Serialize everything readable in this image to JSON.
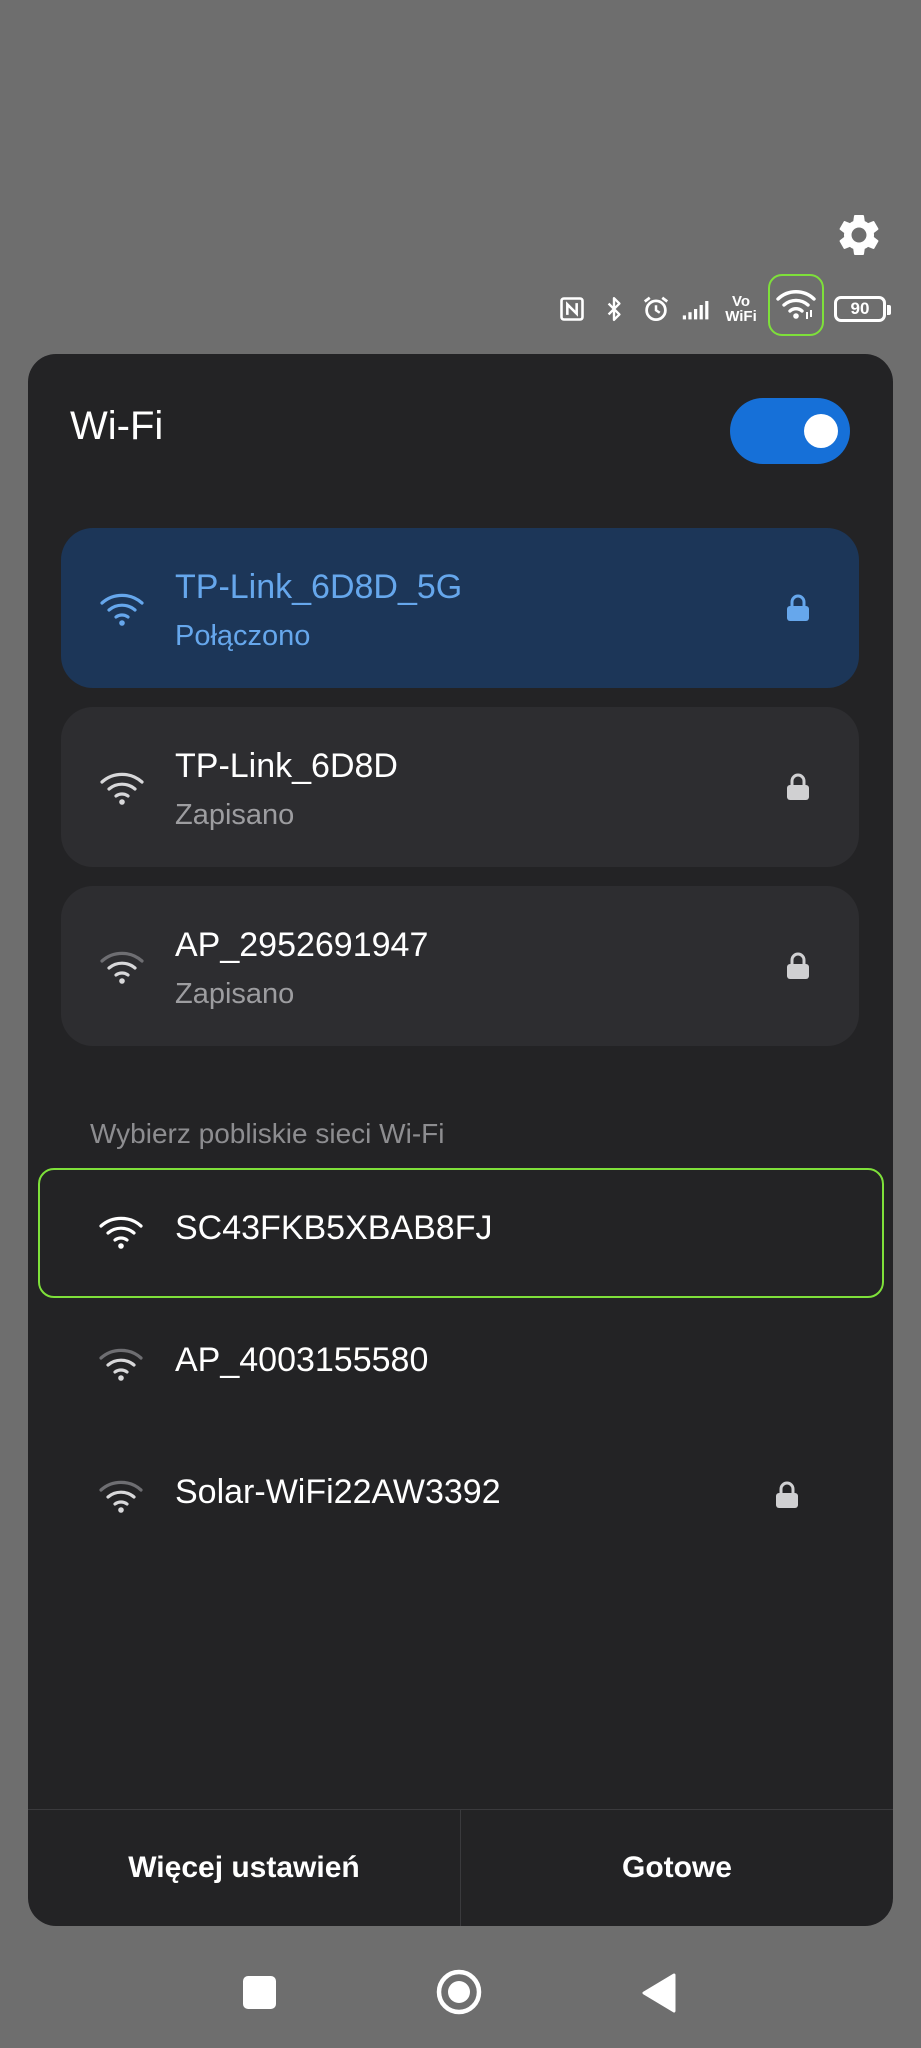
{
  "status_bar": {
    "icons": [
      "nfc-icon",
      "bluetooth-icon",
      "alarm-icon",
      "signal-icon",
      "vowifi-icon",
      "wifi-icon",
      "battery-icon"
    ],
    "vowifi_top": "Vo",
    "vowifi_bottom": "WiFi",
    "battery_level": "90"
  },
  "panel": {
    "title": "Wi-Fi",
    "wifi_enabled": true,
    "saved_networks": [
      {
        "name": "TP-Link_6D8D_5G",
        "status": "Połączono",
        "secured": true,
        "connected": true
      },
      {
        "name": "TP-Link_6D8D",
        "status": "Zapisano",
        "secured": true,
        "connected": false
      },
      {
        "name": "AP_2952691947",
        "status": "Zapisano",
        "secured": true,
        "connected": false
      }
    ],
    "nearby_label": "Wybierz pobliskie sieci Wi-Fi",
    "nearby_networks": [
      {
        "name": "SC43FKB5XBAB8FJ",
        "secured": false
      },
      {
        "name": "AP_4003155580",
        "secured": false
      },
      {
        "name": "Solar-WiFi22AW3392",
        "secured": true
      }
    ],
    "more_settings_label": "Więcej ustawień",
    "done_label": "Gotowe"
  },
  "colors": {
    "accent": "#1670d8",
    "connected_text": "#66a7ec",
    "panel_bg": "#232325",
    "highlight": "#7ee03a"
  }
}
